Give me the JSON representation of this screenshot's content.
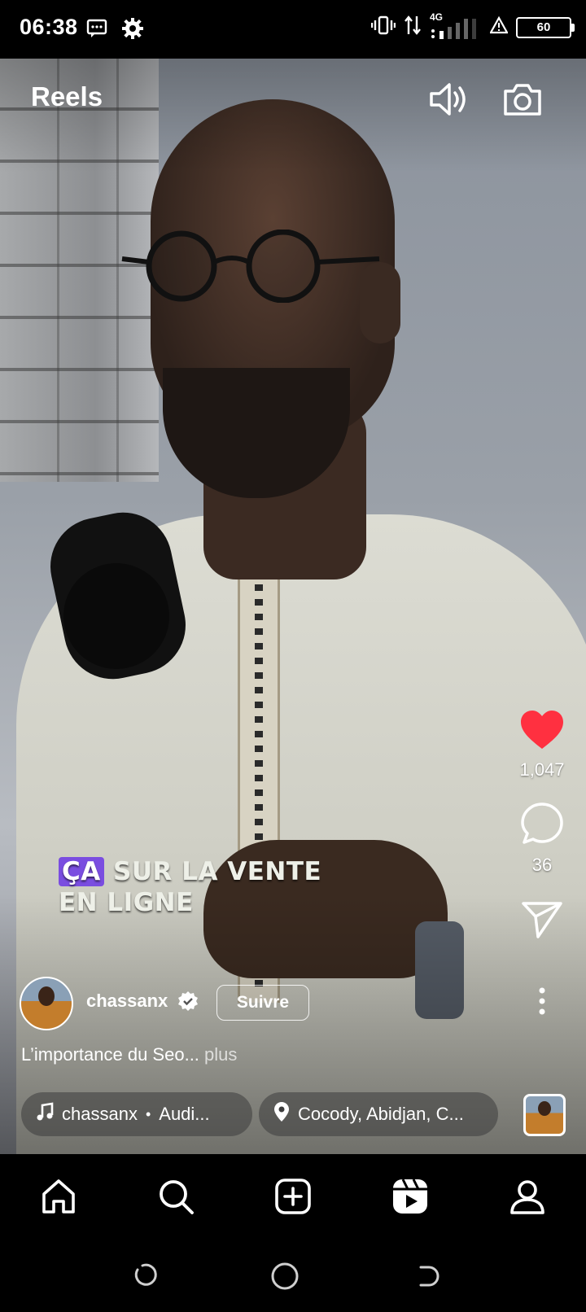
{
  "status_bar": {
    "time": "06:38",
    "network": "4G",
    "battery": "60",
    "icons": [
      "message-icon",
      "settings-icon",
      "vibrate-icon",
      "data-arrows-icon",
      "signal-icon",
      "alert-icon",
      "battery-icon"
    ]
  },
  "header": {
    "title": "Reels",
    "sound_icon": "speaker-icon",
    "camera_icon": "camera-icon"
  },
  "video_caption": {
    "highlight": "ÇA",
    "line1_rest": " SUR LA VENTE",
    "line2": "EN LIGNE"
  },
  "actions": {
    "likes": "1,047",
    "comments": "36",
    "like_color": "#ff3040"
  },
  "author": {
    "username": "chassanx",
    "follow_label": "Suivre"
  },
  "description": {
    "text": "L’importance du Seo...",
    "more": " plus"
  },
  "audio": {
    "artist": "chassanx",
    "separator": "•",
    "title": "Audi..."
  },
  "location": {
    "text": "Cocody, Abidjan, C..."
  },
  "bottom_nav": [
    "home-icon",
    "search-icon",
    "create-icon",
    "reels-icon",
    "profile-icon"
  ],
  "system_nav": [
    "recent-apps-icon",
    "home-circle-icon",
    "back-icon"
  ]
}
